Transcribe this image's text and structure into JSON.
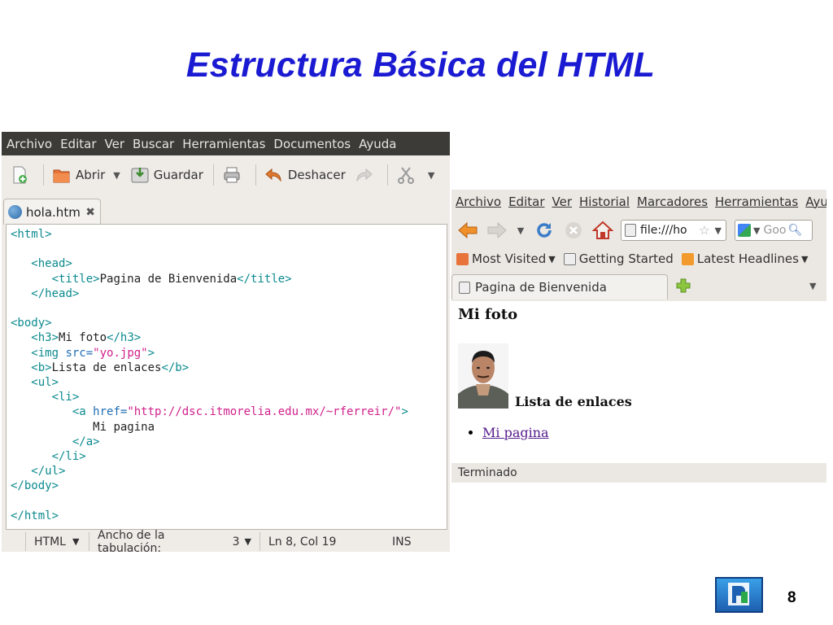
{
  "slide": {
    "title": "Estructura Básica del HTML",
    "page_number": "8"
  },
  "editor": {
    "menu": [
      "Archivo",
      "Editar",
      "Ver",
      "Buscar",
      "Herramientas",
      "Documentos",
      "Ayuda"
    ],
    "toolbar": {
      "open_label": "Abrir",
      "save_label": "Guardar",
      "undo_label": "Deshacer"
    },
    "tab_label": "hola.htm",
    "code": {
      "l_html_open": "<html>",
      "l_head_open": "<head>",
      "l_title_open": "<title>",
      "l_title_text": "Pagina de Bienvenida",
      "l_title_close": "</title>",
      "l_head_close": "</head>",
      "l_body_open": "<body>",
      "l_h3_open": "<h3>",
      "l_h3_text": "Mi foto",
      "l_h3_close": "</h3>",
      "l_img_tag": "<img ",
      "l_img_attr": "src=",
      "l_img_val": "\"yo.jpg\"",
      "l_img_end": ">",
      "l_b_open": "<b>",
      "l_b_text": "Lista de enlaces",
      "l_b_close": "</b>",
      "l_ul_open": "<ul>",
      "l_li_open": "<li>",
      "l_a_tag": "<a ",
      "l_a_attr": "href=",
      "l_a_val": "\"http://dsc.itmorelia.edu.mx/~rferreir/\"",
      "l_a_end": ">",
      "l_a_text": "Mi pagina",
      "l_a_close": "</a>",
      "l_li_close": "</li>",
      "l_ul_close": "</ul>",
      "l_body_close": "</body>",
      "l_html_close": "</html>"
    },
    "status": {
      "language": "HTML",
      "tab_width_label": "Ancho de la tabulación:",
      "tab_width_value": "3",
      "cursor": "Ln 8, Col 19",
      "mode": "INS"
    }
  },
  "browser": {
    "menu": [
      "Archivo",
      "Editar",
      "Ver",
      "Historial",
      "Marcadores",
      "Herramientas",
      "Ayuda"
    ],
    "url": "file:///ho",
    "search_placeholder": "Goo",
    "bookmarks": [
      "Most Visited",
      "Getting Started",
      "Latest Headlines"
    ],
    "tab_label": "Pagina de Bienvenida",
    "page": {
      "heading": "Mi foto",
      "bold_text": "Lista de enlaces",
      "link_text": "Mi pagina"
    },
    "status": "Terminado"
  },
  "colors": {
    "title": "#1a1ad2",
    "editor_menubar": "#3c3b37",
    "code_tag": "#0c8a8f",
    "code_attr": "#1f6db3",
    "code_string": "#d0218c",
    "link_visited": "#551a8b"
  },
  "icons": [
    "new-file-icon",
    "open-folder-icon",
    "save-icon",
    "print-icon",
    "undo-icon",
    "redo-icon",
    "cut-icon",
    "globe-icon",
    "close-icon",
    "back-arrow-icon",
    "forward-arrow-icon",
    "reload-icon",
    "stop-icon",
    "home-icon",
    "star-icon",
    "google-icon",
    "search-icon",
    "rss-icon",
    "new-tab-plus-icon"
  ]
}
